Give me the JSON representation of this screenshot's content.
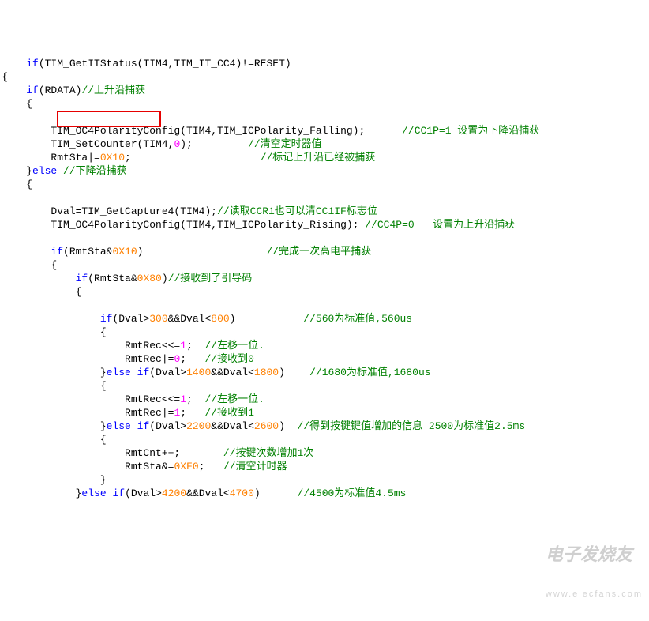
{
  "code": {
    "l01a": "    ",
    "l01b": "if",
    "l01c": "(TIM_GetITStatus(TIM4,TIM_IT_CC4)!=RESET)",
    "l02a": "{",
    "l03a": "    ",
    "l03b": "if",
    "l03c": "(RDATA)",
    "l03d": "//上升沿捕获",
    "l04a": "    {",
    "l05a": "",
    "l06a": "        TIM_OC4PolarityConfig(TIM4,TIM_ICPolarity_Falling);      ",
    "l06b": "//CC1P=1 设置为下降沿捕获",
    "l07a": "        TIM_SetCounter(TIM4,",
    "l07b": "0",
    "l07c": ");         ",
    "l07d": "//清空定时器值",
    "l08a": "        RmtSta|=",
    "l08b": "0X10",
    "l08c": ";                     ",
    "l08d": "//标记上升沿已经被捕获",
    "l09a": "    }",
    "l09b": "else",
    "l09c": " ",
    "l09d": "//下降沿捕获",
    "l10a": "    {",
    "l11a": "",
    "l12a": "        Dval=TIM_GetCapture4(TIM4);",
    "l12b": "//读取CCR1也可以清CC1IF标志位",
    "l13a": "        TIM_OC4PolarityConfig(TIM4,TIM_ICPolarity_Rising); ",
    "l13b": "//CC4P=0   设置为上升沿捕获",
    "l14a": "",
    "l15a": "        ",
    "l15b": "if",
    "l15c": "(RmtSta&",
    "l15d": "0X10",
    "l15e": ")                    ",
    "l15f": "//完成一次高电平捕获",
    "l16a": "        {",
    "l17a": "            ",
    "l17b": "if",
    "l17c": "(RmtSta&",
    "l17d": "0X80",
    "l17e": ")",
    "l17f": "//接收到了引导码",
    "l18a": "            {",
    "l19a": "",
    "l20a": "                ",
    "l20b": "if",
    "l20c": "(Dval>",
    "l20d": "300",
    "l20e": "&&Dval<",
    "l20f": "800",
    "l20g": ")           ",
    "l20h": "//560为标准值,560us",
    "l21a": "                {",
    "l22a": "                    RmtRec<<=",
    "l22b": "1",
    "l22c": ";  ",
    "l22d": "//左移一位.",
    "l23a": "                    RmtRec|=",
    "l23b": "0",
    "l23c": ";   ",
    "l23d": "//接收到0",
    "l24a": "                }",
    "l24b": "else",
    "l24c": " ",
    "l24d": "if",
    "l24e": "(Dval>",
    "l24f": "1400",
    "l24g": "&&Dval<",
    "l24h": "1800",
    "l24i": ")    ",
    "l24j": "//1680为标准值,1680us",
    "l25a": "                {",
    "l26a": "                    RmtRec<<=",
    "l26b": "1",
    "l26c": ";  ",
    "l26d": "//左移一位.",
    "l27a": "                    RmtRec|=",
    "l27b": "1",
    "l27c": ";   ",
    "l27d": "//接收到1",
    "l28a": "                }",
    "l28b": "else",
    "l28c": " ",
    "l28d": "if",
    "l28e": "(Dval>",
    "l28f": "2200",
    "l28g": "&&Dval<",
    "l28h": "2600",
    "l28i": ")  ",
    "l28j": "//得到按键键值增加的信息 2500为标准值2.5ms",
    "l29a": "                {",
    "l30a": "                    RmtCnt++;       ",
    "l30b": "//按键次数增加1次",
    "l31a": "                    RmtSta&=",
    "l31b": "0XF0",
    "l31c": ";   ",
    "l31d": "//清空计时器",
    "l32a": "                }",
    "l33a": "            }",
    "l33b": "else",
    "l33c": " ",
    "l33d": "if",
    "l33e": "(Dval>",
    "l33f": "4200",
    "l33g": "&&Dval<",
    "l33h": "4700",
    "l33i": ")      ",
    "l33j": "//4500为标准值4.5ms"
  },
  "watermark": {
    "brand": "电子发烧友",
    "url": "www.elecfans.com"
  }
}
